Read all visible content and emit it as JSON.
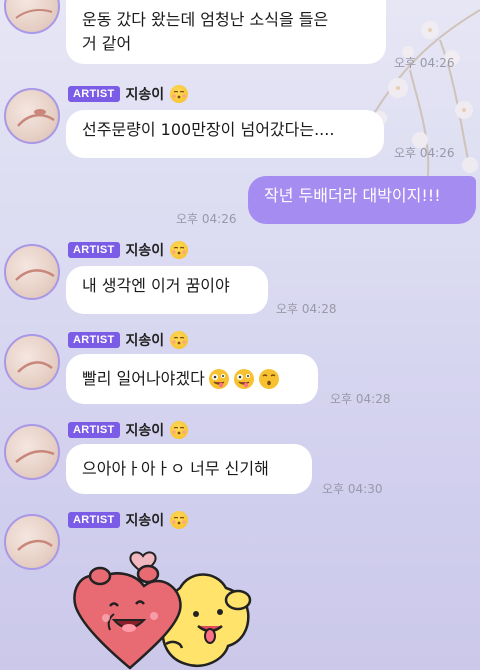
{
  "messages": [
    {
      "text_line1": "운동 갔다 왔는데 엄청난 소식을 들은",
      "text_line2": "거 같어",
      "time": "오후 04:26"
    },
    {
      "badge": "ARTIST",
      "sender": "지송이",
      "text": "선주문량이 100만장이 넘어갔다는....",
      "time": "오후 04:26"
    },
    {
      "text": "작년 두배더라 대박이지!!!",
      "time": "오후 04:26"
    },
    {
      "badge": "ARTIST",
      "sender": "지송이",
      "text": "내 생각엔 이거 꿈이야",
      "time": "오후 04:28"
    },
    {
      "badge": "ARTIST",
      "sender": "지송이",
      "text": "빨리 일어나야겠다",
      "time": "오후 04:28"
    },
    {
      "badge": "ARTIST",
      "sender": "지송이",
      "text": "으아아ㅏ아ㅏㅇ 너무 신기해",
      "time": "오후 04:30"
    },
    {
      "badge": "ARTIST",
      "sender": "지송이"
    }
  ],
  "colors": {
    "accent": "#7b5ce6",
    "outgoing_bubble": "#a58cf0",
    "incoming_bubble": "#ffffff"
  },
  "icons": {
    "sender_emoji": "kissing-face-emoji",
    "laugh_emoji": "zany-face-emoji",
    "flushed_emoji": "kissing-face-emoji"
  }
}
